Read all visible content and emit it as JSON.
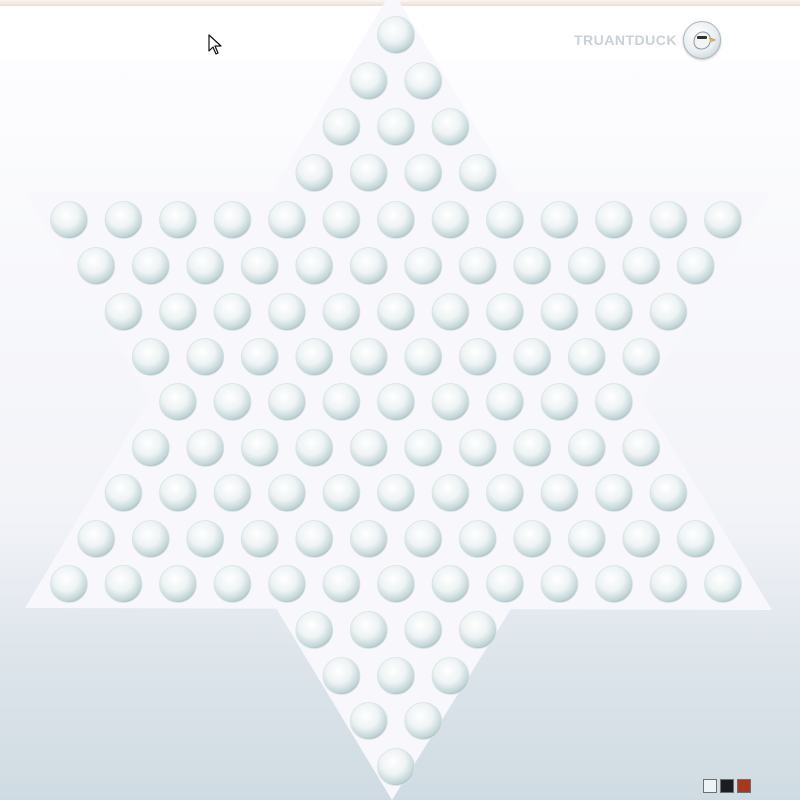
{
  "brand": {
    "name": "TRUANTDUCK",
    "logo_icon": "duck-logo-icon"
  },
  "board": {
    "type": "chinese-checkers-star",
    "hole_count": 121,
    "board_color": "#f7f7fc",
    "hole_highlight": "#ffffff",
    "hole_shade": "#a9c3c6"
  },
  "swatches": [
    {
      "name": "white-theme",
      "color": "#eef3f6"
    },
    {
      "name": "black-theme",
      "color": "#1b1d21"
    },
    {
      "name": "wood-theme",
      "color": "#a8381d"
    }
  ]
}
